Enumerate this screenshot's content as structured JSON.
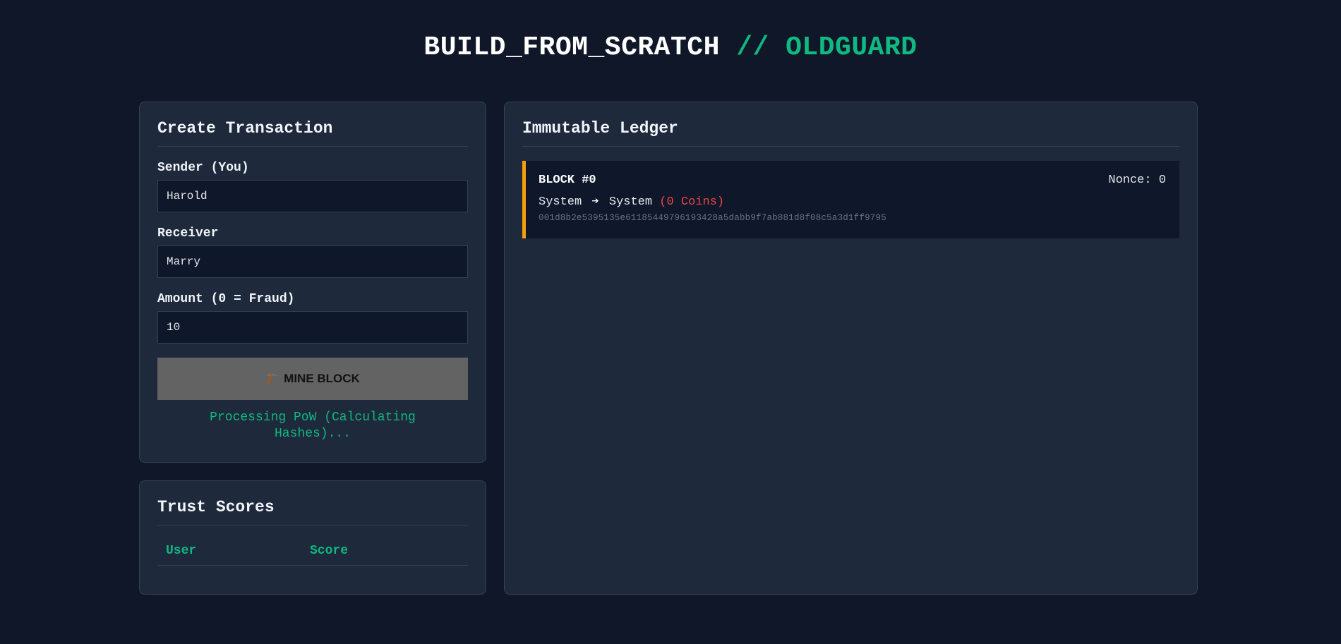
{
  "header": {
    "title_main": "BUILD_FROM_SCRATCH",
    "title_sep": "//",
    "title_accent": "OLDGUARD"
  },
  "transaction_panel": {
    "heading": "Create Transaction",
    "sender_label": "Sender (You)",
    "sender_value": "Harold",
    "receiver_label": "Receiver",
    "receiver_value": "Marry",
    "amount_label": "Amount (0 = Fraud)",
    "amount_value": "10",
    "mine_button_label": "MINE BLOCK",
    "mine_button_icon": "pickaxe-icon",
    "status": "Processing PoW (Calculating Hashes)..."
  },
  "trust_panel": {
    "heading": "Trust Scores",
    "columns": [
      "User",
      "Score"
    ],
    "rows": []
  },
  "ledger_panel": {
    "heading": "Immutable Ledger",
    "blocks": [
      {
        "label": "BLOCK #0",
        "nonce_label": "Nonce: 0",
        "from": "System",
        "arrow": "➔",
        "to": "System",
        "amount": "(0 Coins)",
        "hash": "001d8b2e5395135e61185449796193428a5dabb9f7ab881d8f08c5a3d1ff9795"
      }
    ]
  },
  "colors": {
    "background": "#0f1729",
    "panel": "#1e293b",
    "accent": "#10b981",
    "block_border": "#f59e0b",
    "fraud_amount": "#ef4444"
  }
}
